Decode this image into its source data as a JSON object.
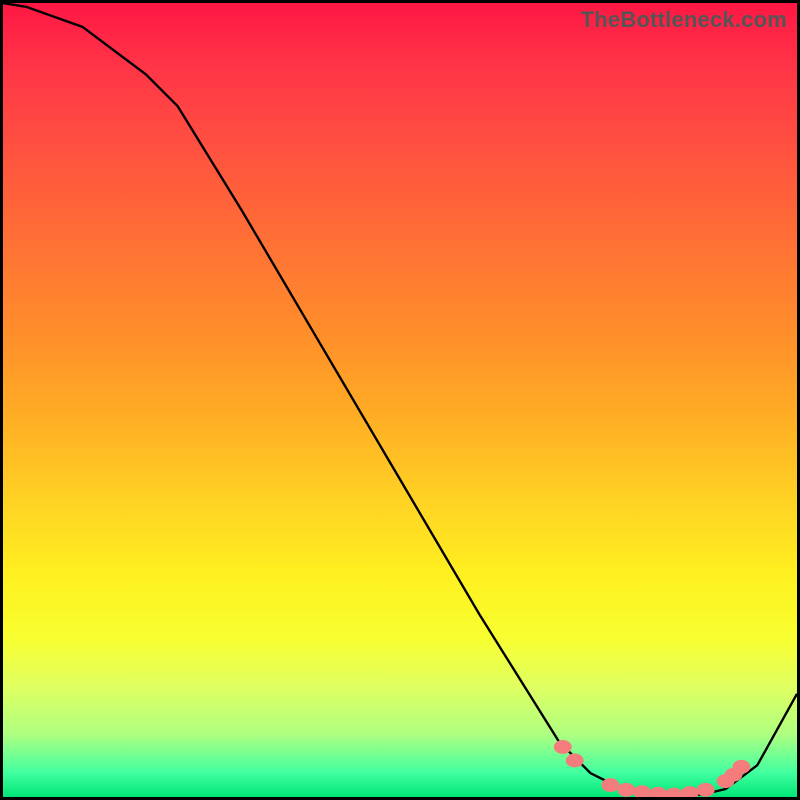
{
  "watermark": "TheBottleneck.com",
  "chart_data": {
    "type": "line",
    "title": "",
    "xlabel": "",
    "ylabel": "",
    "xlim": [
      0,
      100
    ],
    "ylim": [
      0,
      100
    ],
    "series": [
      {
        "name": "curve",
        "x": [
          0,
          3,
          10,
          18,
          22,
          30,
          40,
          50,
          60,
          70,
          74,
          78,
          82,
          85,
          88,
          91,
          95,
          100
        ],
        "y": [
          100,
          99.5,
          97,
          91,
          87,
          74,
          57,
          40,
          23,
          7,
          3,
          1,
          0.3,
          0.2,
          0.3,
          1,
          4,
          13
        ]
      }
    ],
    "markers": [
      {
        "x": 70.5,
        "y": 6.3
      },
      {
        "x": 72.0,
        "y": 4.6
      },
      {
        "x": 76.5,
        "y": 1.5
      },
      {
        "x": 78.5,
        "y": 0.9
      },
      {
        "x": 80.5,
        "y": 0.6
      },
      {
        "x": 82.5,
        "y": 0.4
      },
      {
        "x": 84.5,
        "y": 0.3
      },
      {
        "x": 86.5,
        "y": 0.5
      },
      {
        "x": 88.5,
        "y": 0.9
      },
      {
        "x": 91.0,
        "y": 2.0
      },
      {
        "x": 92.0,
        "y": 2.8
      },
      {
        "x": 93.0,
        "y": 3.8
      }
    ],
    "marker_color": "#f57c7c"
  }
}
